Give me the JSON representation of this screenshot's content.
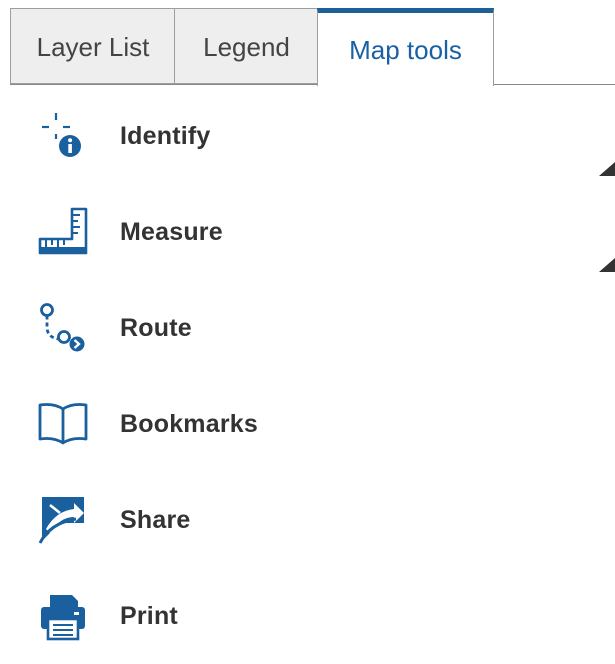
{
  "tabs": [
    {
      "label": "Layer List",
      "active": false
    },
    {
      "label": "Legend",
      "active": false
    },
    {
      "label": "Map tools",
      "active": true
    }
  ],
  "tools": [
    {
      "label": "Identify",
      "icon": "identify-icon"
    },
    {
      "label": "Measure",
      "icon": "ruler-icon"
    },
    {
      "label": "Route",
      "icon": "route-icon"
    },
    {
      "label": "Bookmarks",
      "icon": "book-icon"
    },
    {
      "label": "Share",
      "icon": "share-icon"
    },
    {
      "label": "Print",
      "icon": "printer-icon"
    }
  ],
  "colors": {
    "accent": "#1d5f96",
    "active_tab_text": "#1a61a3",
    "icon": "#1a5f9e",
    "tool_text": "#333333",
    "inactive_tab_bg": "#eeeeee"
  }
}
